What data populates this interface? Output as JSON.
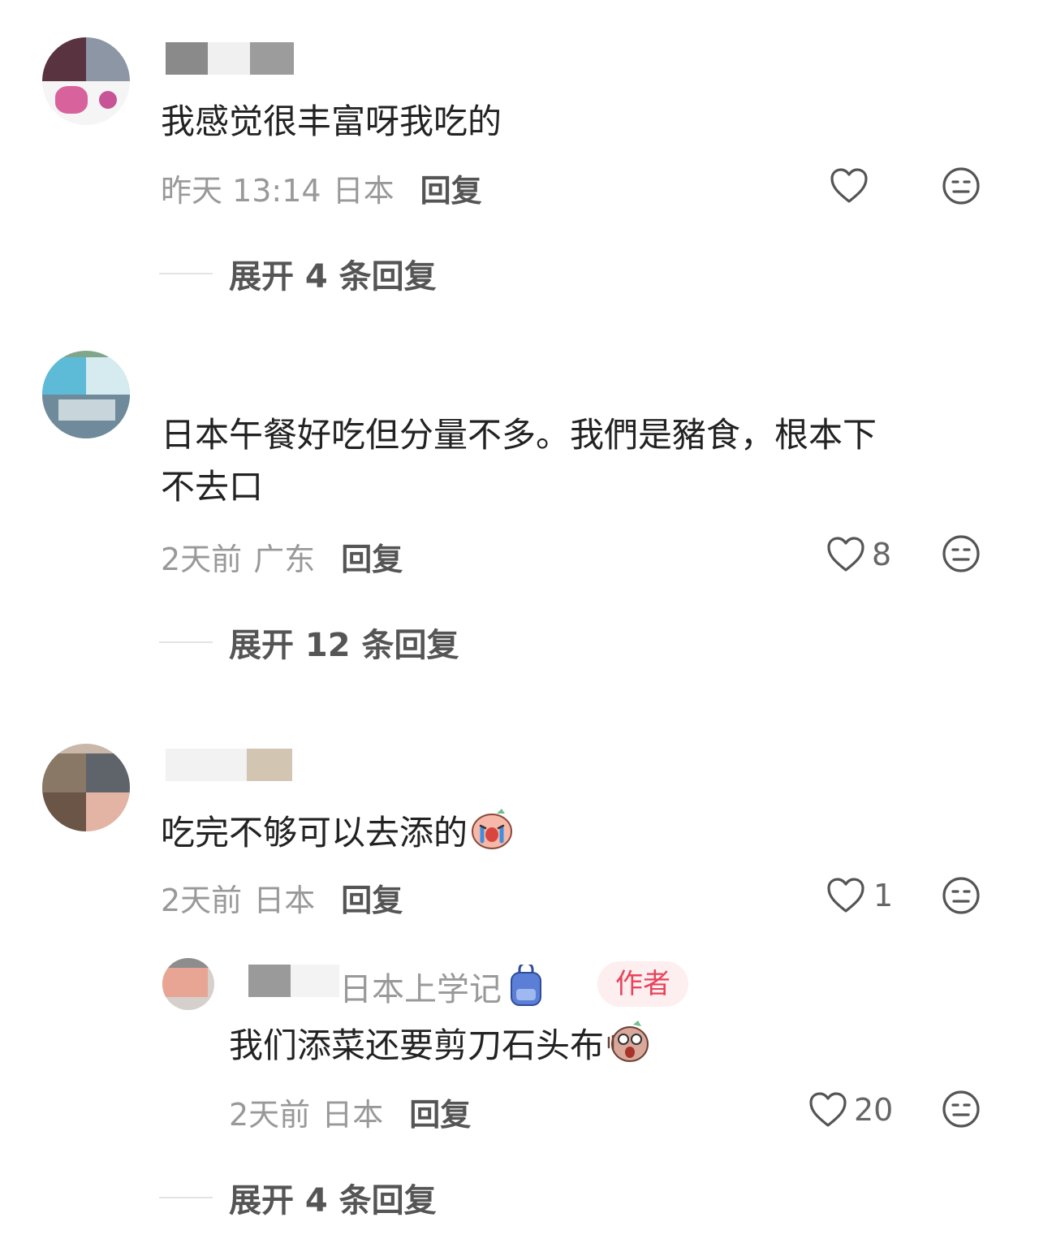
{
  "comments": [
    {
      "content": "我感觉很丰富呀我吃的",
      "time": "昨天 13:14",
      "location": "日本",
      "reply_label": "回复",
      "likes": "",
      "expand": "展开 4 条回复"
    },
    {
      "content_line1": "日本午餐好吃但分量不多。我們是豬食，根本下",
      "content_line2": "不去口",
      "time": "2天前",
      "location": "广东",
      "reply_label": "回复",
      "likes": "8",
      "expand": "展开 12 条回复"
    },
    {
      "content": "吃完不够可以去添的",
      "time": "2天前",
      "location": "日本",
      "reply_label": "回复",
      "likes": "1",
      "reply": {
        "name": "日本上学记",
        "badge": "作者",
        "content": "我们添菜还要剪刀石头布",
        "time": "2天前",
        "location": "日本",
        "reply_label": "回复",
        "likes": "20"
      },
      "expand": "展开 4 条回复"
    }
  ],
  "icons": {
    "like": "heart-outline-icon",
    "dislike": "neutral-face-icon",
    "emoji_cry": "crying-emoji",
    "emoji_shock": "shocked-emoji",
    "backpack": "backpack-emoji"
  },
  "colors": {
    "text": "#222222",
    "meta": "#999999",
    "icon": "#555555",
    "author_badge_bg": "#fdeef0",
    "author_badge_text": "#e8435a"
  }
}
